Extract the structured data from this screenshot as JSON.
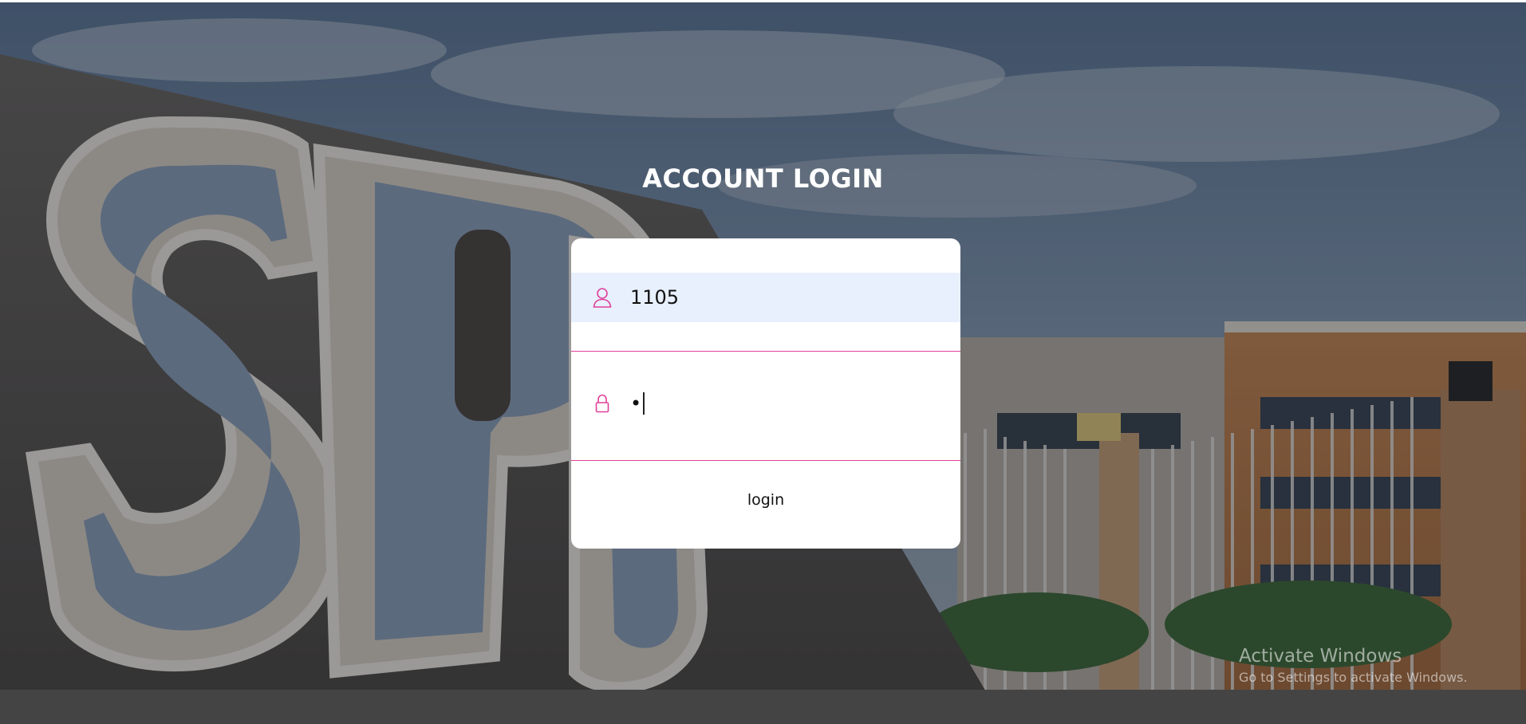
{
  "page": {
    "title": "ACCOUNT LOGIN"
  },
  "login_form": {
    "username_value": "1105",
    "password_mask": "•",
    "login_label": "login",
    "username_icon": "user-icon",
    "password_icon": "lock-icon"
  },
  "colors": {
    "accent": "#e0409a",
    "autofill_bg": "#e8f0fe",
    "card_bg": "#ffffff"
  },
  "watermark": {
    "line1": "Activate Windows",
    "line2": "Go to Settings to activate Windows."
  }
}
